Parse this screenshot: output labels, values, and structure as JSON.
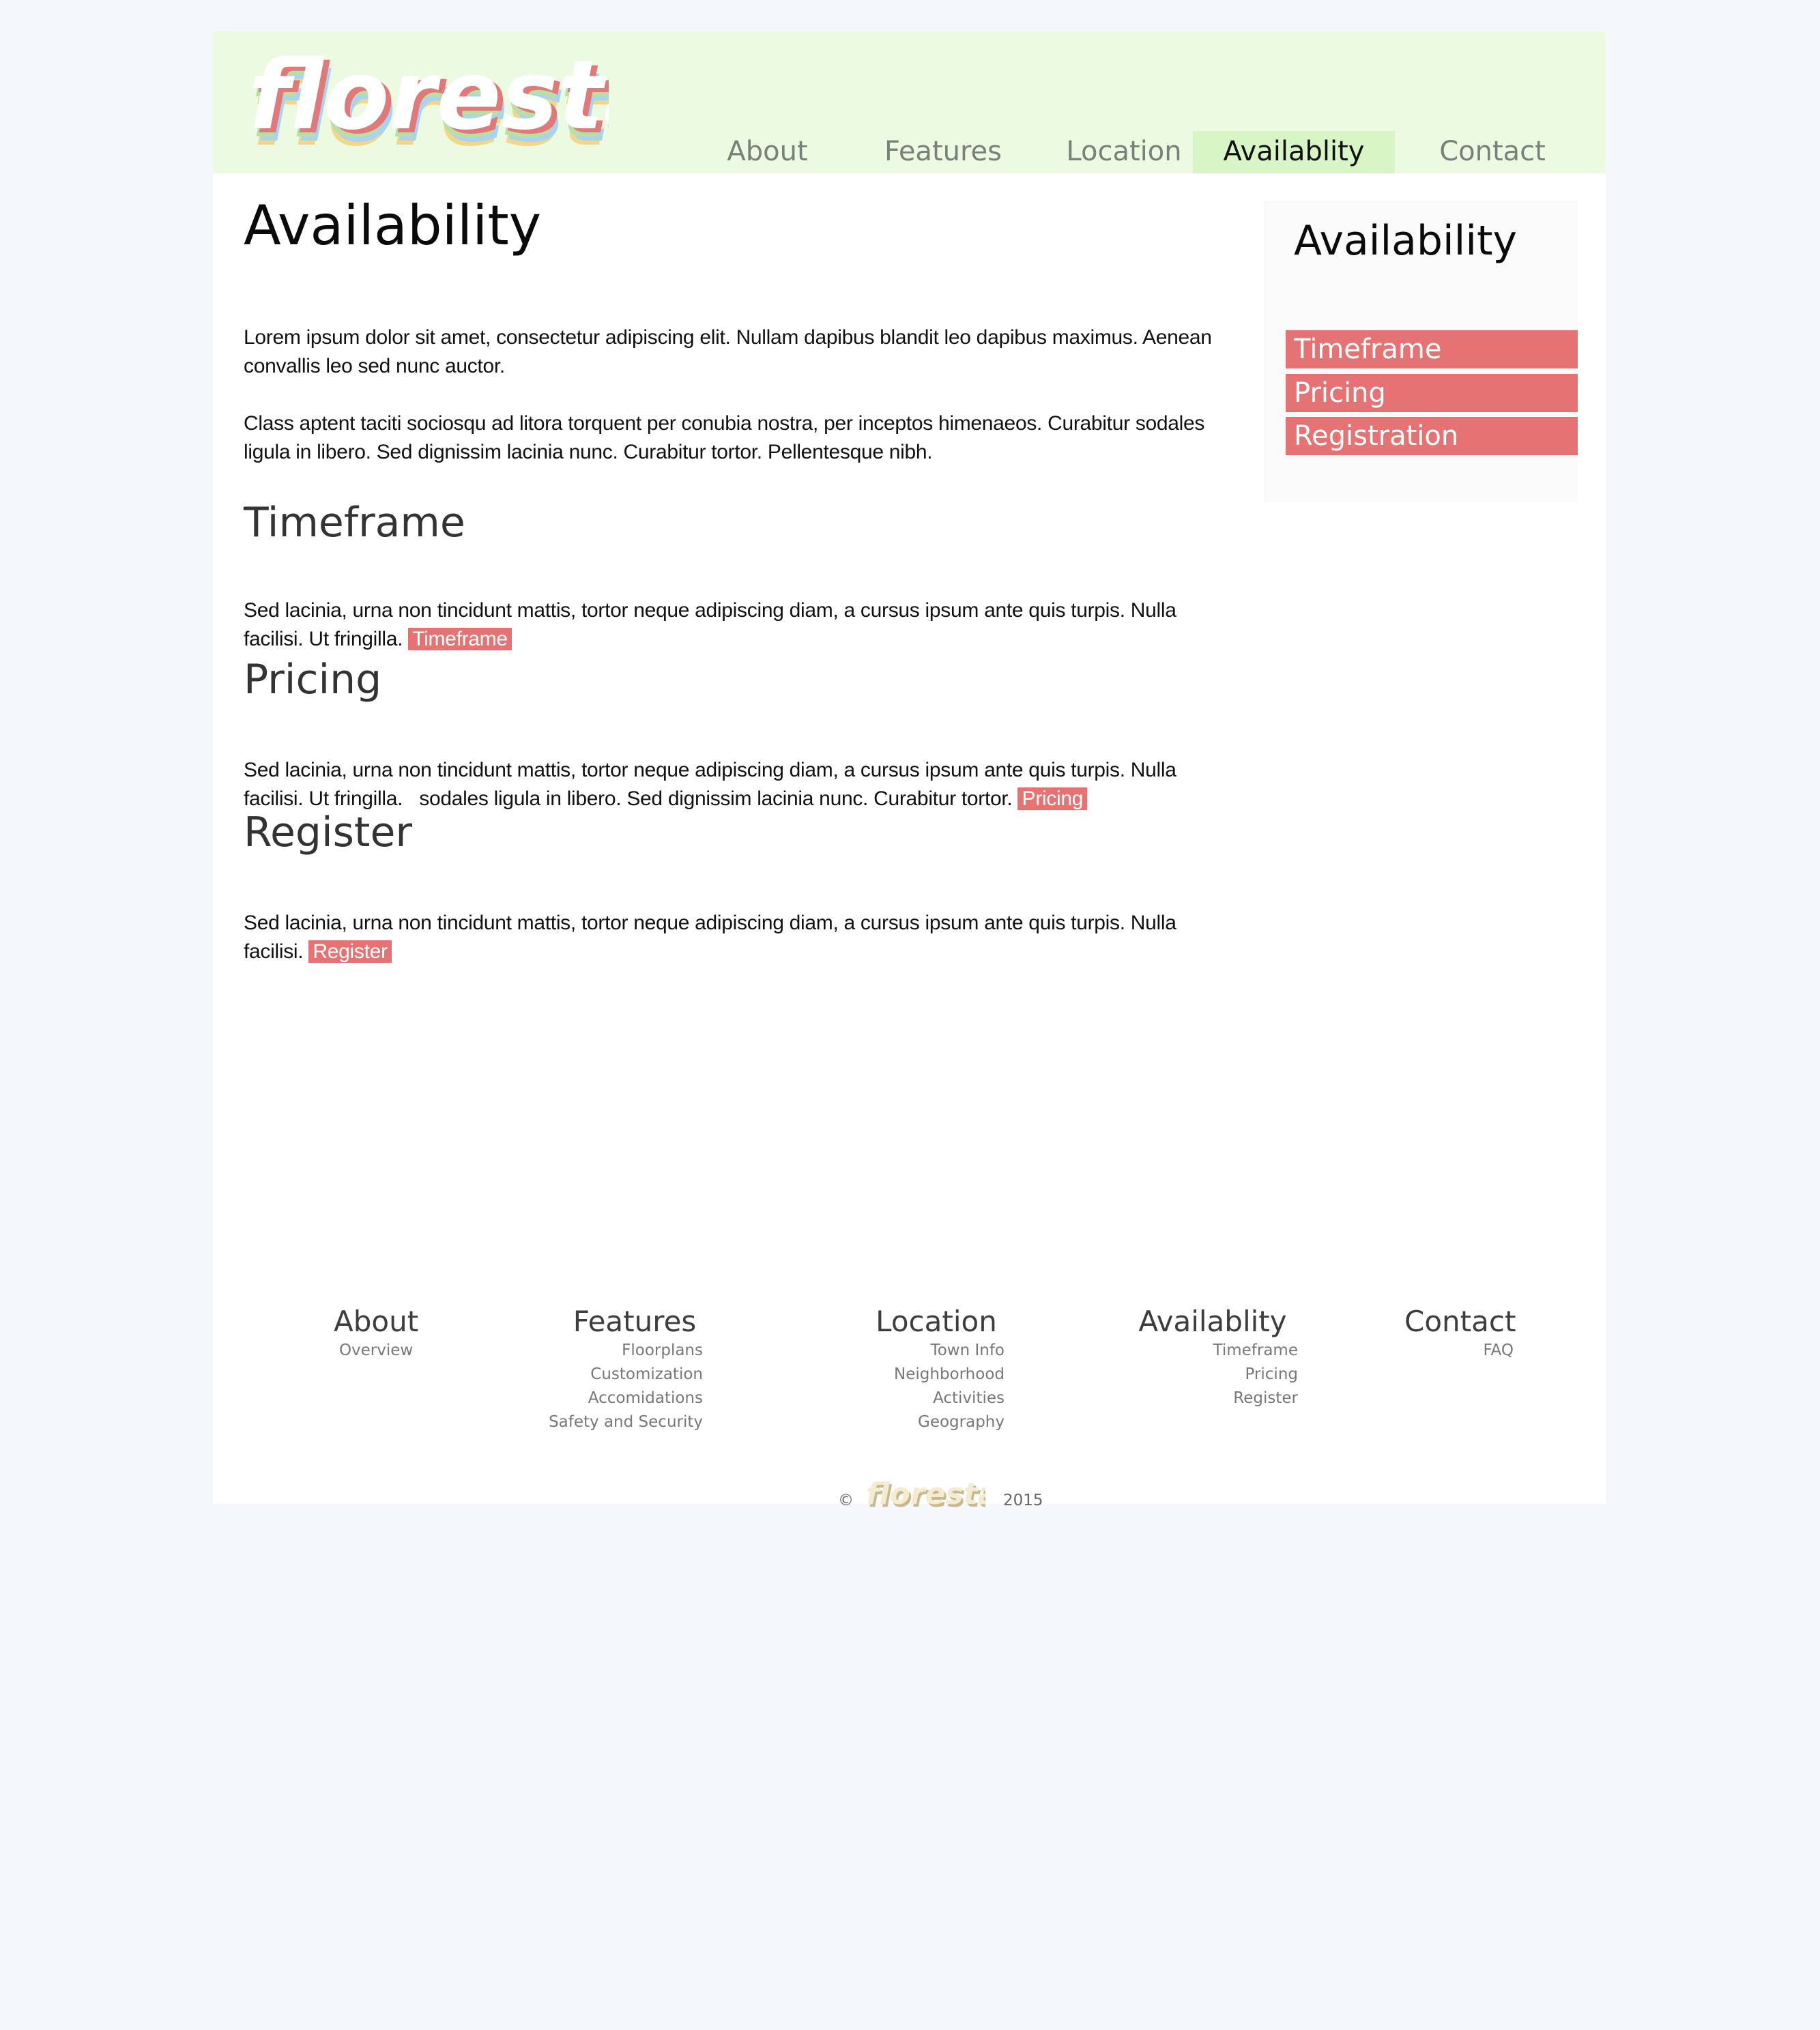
{
  "brand": {
    "name": "floresta"
  },
  "nav": {
    "items": [
      {
        "label": "About"
      },
      {
        "label": "Features"
      },
      {
        "label": "Location"
      },
      {
        "label": "Availablity"
      },
      {
        "label": "Contact"
      }
    ],
    "active_index": 3
  },
  "main": {
    "title": "Availability",
    "intro": [
      "Lorem ipsum dolor sit amet, consectetur adipiscing elit. Nullam dapibus blandit leo dapibus maximus. Aenean convallis leo sed nunc auctor.",
      "Class aptent taciti sociosqu ad litora torquent per conubia nostra, per inceptos himenaeos. Curabitur sodales ligula in libero. Sed dignissim lacinia nunc. Curabitur tortor. Pellentesque nibh."
    ],
    "sections": [
      {
        "title": "Timeframe",
        "text": "Sed lacinia, urna non tincidunt mattis, tortor neque adipiscing diam, a cursus ipsum ante quis turpis. Nulla facilisi. Ut fringilla.",
        "link": "Timeframe"
      },
      {
        "title": "Pricing",
        "text": "Sed lacinia, urna non tincidunt mattis, tortor neque adipiscing diam, a cursus ipsum ante quis turpis. Nulla facilisi. Ut fringilla.   sodales ligula in libero. Sed dignissim lacinia nunc. Curabitur tortor.",
        "link": "Pricing"
      },
      {
        "title": "Register",
        "text": "Sed lacinia, urna non tincidunt mattis, tortor neque adipiscing diam, a cursus ipsum ante quis turpis. Nulla facilisi.",
        "link": "Register"
      }
    ]
  },
  "sidebar": {
    "title": "Availability",
    "links": [
      {
        "label": "Timeframe"
      },
      {
        "label": "Pricing"
      },
      {
        "label": "Registration"
      }
    ]
  },
  "footer": {
    "columns": [
      {
        "title": "About",
        "links": [
          "Overview"
        ]
      },
      {
        "title": "Features",
        "links": [
          "Floorplans",
          "Customization",
          "Accomidations",
          "Safety and Security"
        ]
      },
      {
        "title": "Location",
        "links": [
          "Town Info",
          "Neighborhood",
          "Activities",
          "Geography"
        ]
      },
      {
        "title": "Availablity",
        "links": [
          "Timeframe",
          "Pricing",
          "Register"
        ]
      },
      {
        "title": "Contact",
        "links": [
          "FAQ"
        ]
      }
    ],
    "copyright_symbol": "©",
    "year": "2015"
  },
  "colors": {
    "background": "#f4f7fc",
    "header": "#ecfae1",
    "nav_active": "#d7f5c5",
    "accent": "#e57373",
    "sidebar": "#fafafa"
  }
}
